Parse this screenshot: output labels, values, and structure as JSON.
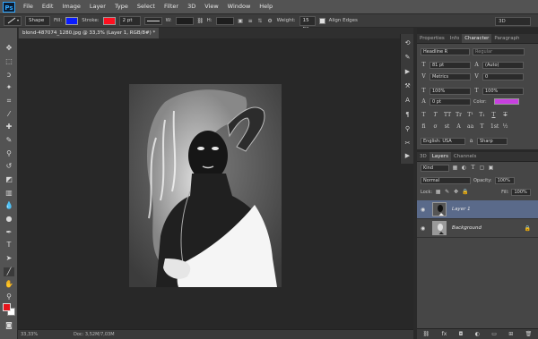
{
  "app": {
    "logo": "Ps"
  },
  "menu": [
    "File",
    "Edit",
    "Image",
    "Layer",
    "Type",
    "Select",
    "Filter",
    "3D",
    "View",
    "Window",
    "Help"
  ],
  "options": {
    "mode": "Shape",
    "fill_label": "Fill:",
    "fill_color": "#0a1cff",
    "stroke_label": "Stroke:",
    "stroke_color": "#ff1020",
    "stroke_width": "2 pt",
    "w_label": "W:",
    "h_label": "H:",
    "weight_label": "Weight:",
    "weight_value": "15 px",
    "align_edges": "Align Edges",
    "workspace": "3D"
  },
  "document": {
    "tab_title": "blond-487074_1280.jpg @ 33,3% (Layer 1, RGB/8#) *",
    "zoom": "33,33%",
    "doc_size": "Doc: 3,52M/7,03M"
  },
  "colors": {
    "foreground": "#e8141b",
    "background": "#ffffff"
  },
  "character_panel": {
    "tabs": [
      "Properties",
      "Info",
      "Character",
      "Paragraph"
    ],
    "active_tab": "Character",
    "font_family": "Headline R",
    "font_style": "Regular",
    "font_size": "81 pt",
    "leading": "(Auto)",
    "kerning": "Metrics",
    "tracking": "0",
    "vertical_scale": "100%",
    "horizontal_scale": "100%",
    "baseline_shift": "0 pt",
    "color_label": "Color:",
    "text_color": "#c840e0",
    "style_buttons": [
      "T",
      "T",
      "TT",
      "Tr",
      "T¹",
      "T₁",
      "T",
      "T"
    ],
    "opentype_buttons": [
      "fi",
      "σ",
      "st",
      "A",
      "aa",
      "T",
      "1st",
      "½"
    ],
    "language": "English: USA",
    "antialias": "Sharp"
  },
  "layers_panel": {
    "tabs": [
      "3D",
      "Layers",
      "Channels"
    ],
    "active_tab": "Layers",
    "filter": "Kind",
    "blend_mode": "Normal",
    "opacity_label": "Opacity:",
    "opacity": "100%",
    "lock_label": "Lock:",
    "fill_label": "Fill:",
    "fill": "100%",
    "layers": [
      {
        "name": "Layer 1",
        "selected": true
      },
      {
        "name": "Background",
        "selected": false,
        "locked": true
      }
    ]
  }
}
